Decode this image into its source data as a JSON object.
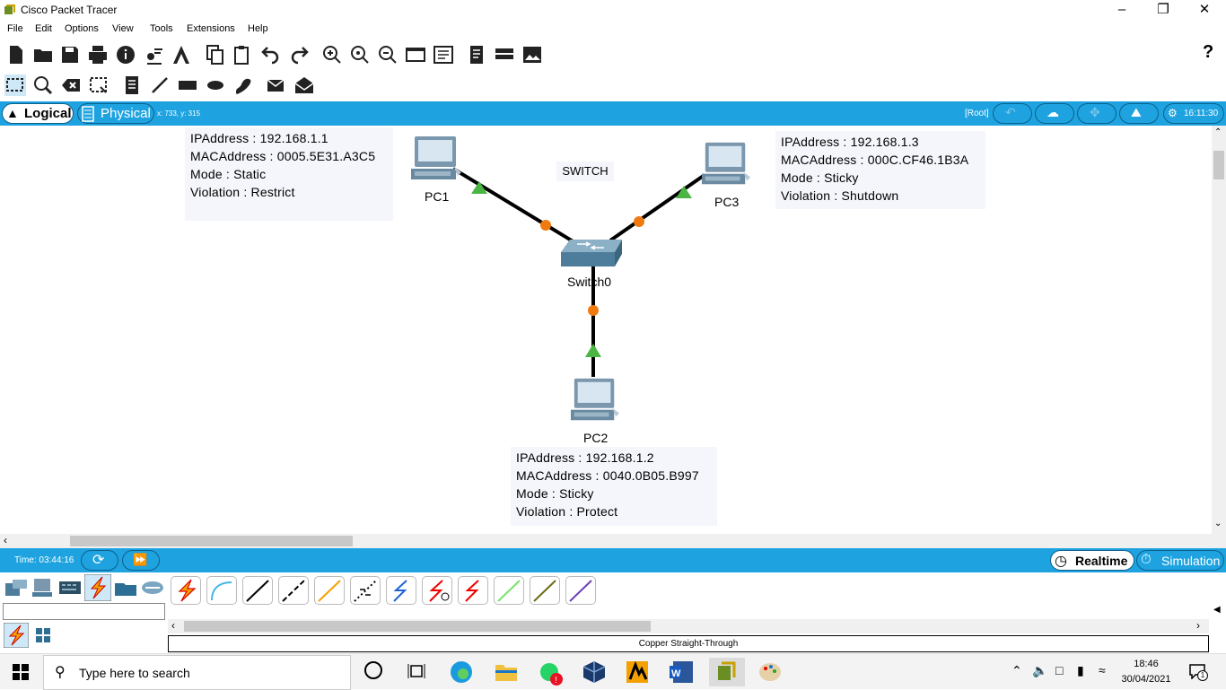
{
  "window": {
    "title": "Cisco Packet Tracer"
  },
  "menu": [
    "File",
    "Edit",
    "Options",
    "View",
    "Tools",
    "Extensions",
    "Help"
  ],
  "workspace": {
    "logical_tab": "Logical",
    "physical_tab": "Physical",
    "coords": "x: 733, y: 315",
    "root": "[Root]",
    "clock": "16:11:30"
  },
  "notes": {
    "pc1": [
      "IPAddress : 192.168.1.1",
      "MACAddress : 0005.5E31.A3C5",
      "Mode : Static",
      "Violation : Restrict"
    ],
    "pc3": [
      "IPAddress : 192.168.1.3",
      "MACAddress : 000C.CF46.1B3A",
      "Mode : Sticky",
      "Violation : Shutdown"
    ],
    "pc2": [
      "IPAddress : 192.168.1.2",
      "MACAddress : 0040.0B05.B997",
      "Mode : Sticky",
      "Violation : Protect"
    ],
    "switch_note": "SWITCH"
  },
  "devices": {
    "pc1": "PC1",
    "pc2": "PC2",
    "pc3": "PC3",
    "switch": "Switch0"
  },
  "simulation": {
    "time": "Time: 03:44:16",
    "realtime": "Realtime",
    "simulation": "Simulation"
  },
  "device_panel": {
    "connection_status": "Copper Straight-Through",
    "search_value": ""
  },
  "taskbar": {
    "search_placeholder": "Type here to search",
    "time": "18:46",
    "date": "30/04/2021",
    "notifications": "1"
  },
  "colors": {
    "accent_blue": "#1ea3e0",
    "link_up": "#4bb543",
    "link_orange": "#f07a10"
  }
}
